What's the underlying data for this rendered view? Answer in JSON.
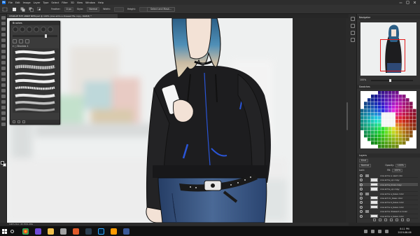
{
  "menu": {
    "app_icon": "Ps",
    "items": [
      "File",
      "Edit",
      "Image",
      "Layer",
      "Type",
      "Select",
      "Filter",
      "3D",
      "View",
      "Window",
      "Help"
    ]
  },
  "options": {
    "feather_label": "Feather:",
    "feather_value": "0 px",
    "style_label": "Style:",
    "style_value": "Normal",
    "width_label": "Width:",
    "height_label": "Height:",
    "select_mask_label": "Select and Mask..."
  },
  "document": {
    "tab_title": "CHARLIE EVE ANNIE NEW.psd @ 100% (one arms a dressed file copy, RGB/8) *",
    "zoom": "100%",
    "status_text": "100%    Doc: 45.7M/1.28G"
  },
  "brushes_panel": {
    "title": "Brushes",
    "folder_label": "Brushes 1"
  },
  "navigator_panel": {
    "title": "Navigator",
    "zoom": "100%"
  },
  "swatches_panel": {
    "title": "Swatches"
  },
  "layers_panel": {
    "title": "Layers",
    "kind_label": "Kind",
    "blend_mode": "Normal",
    "opacity_label": "Opacity:",
    "opacity_value": "100%",
    "lock_label": "Lock:",
    "fill_label": "Fill:",
    "fill_value": "100%",
    "layers": [
      {
        "name": "one arms a  used colo",
        "active": false,
        "folder": true
      },
      {
        "name": "one arms_up copy",
        "active": false,
        "folder": false
      },
      {
        "name": "one arms_lines copy",
        "active": true,
        "folder": false
      },
      {
        "name": "one arms_up copy",
        "active": false,
        "folder": false
      },
      {
        "name": "one arms a_base color",
        "active": false,
        "folder": true
      },
      {
        "name": "one arm b_base color",
        "active": false,
        "folder": false
      },
      {
        "name": "one arms b_base color",
        "active": false,
        "folder": false
      },
      {
        "name": "one arms a_base color",
        "active": false,
        "folder": false
      },
      {
        "name": "one arms dressed a  cover",
        "active": false,
        "folder": true
      },
      {
        "name": "one arms a_base color",
        "active": false,
        "folder": false
      }
    ]
  },
  "taskbar": {
    "time": "8:11 PM",
    "date": "2019-06-06"
  },
  "colors": {
    "accent": "#1473e6",
    "hoodie": "#1d1d1f",
    "zipper": "#2a55d6",
    "hair_dark": "#2c5f86",
    "hair_light": "#e9d7b8",
    "skin": "#f3e2d6",
    "jeans": "#2e4976"
  }
}
